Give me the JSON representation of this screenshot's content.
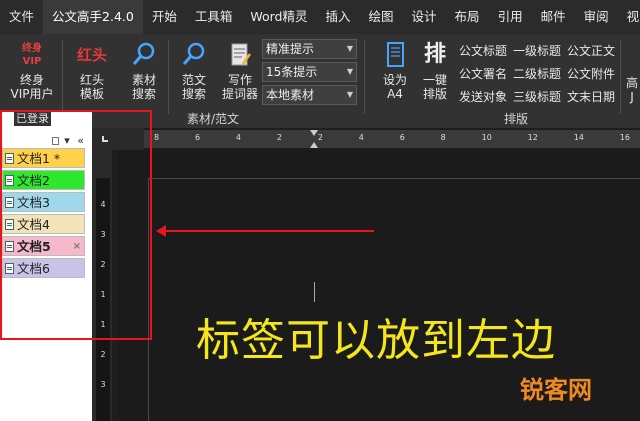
{
  "menubar": {
    "items": [
      "文件",
      "公文高手2.4.0",
      "开始",
      "工具箱",
      "Word精灵",
      "插入",
      "绘图",
      "设计",
      "布局",
      "引用",
      "邮件",
      "审阅",
      "视图"
    ],
    "active_index": 1
  },
  "ribbon": {
    "vip": {
      "icon_line1": "终身",
      "icon_line2": "VIP",
      "label_line1": "终身",
      "label_line2": "VIP用户"
    },
    "hongtou": {
      "icon": "红头",
      "label_line1": "红头",
      "label_line2": "模板"
    },
    "sucai": {
      "label_line1": "素材",
      "label_line2": "搜索"
    },
    "fanwen": {
      "label_line1": "范文",
      "label_line2": "搜索"
    },
    "xiezuo": {
      "label_line1": "写作",
      "label_line2": "提词器"
    },
    "combos": [
      "精准提示",
      "15条提示",
      "本地素材"
    ],
    "group_material": "素材/范文",
    "set_a4": {
      "label_line1": "设为",
      "label_line2": "A4"
    },
    "paiban": {
      "icon": "排",
      "label_line1": "一键",
      "label_line2": "排版"
    },
    "titles_col1": [
      "公文标题",
      "公文署名",
      "发送对象"
    ],
    "titles_col2": [
      "一级标题",
      "二级标题",
      "三级标题"
    ],
    "titles_col3": [
      "公文正文",
      "公文附件",
      "文末日期"
    ],
    "partial": {
      "line1": "高",
      "line2": "J"
    },
    "group_layout": "排版",
    "login_status": "已登录"
  },
  "tabs": [
    {
      "label": "文档1 *",
      "color": "#ffd24a"
    },
    {
      "label": "文档2",
      "color": "#2ee82e"
    },
    {
      "label": "文档3",
      "color": "#9fd8ea"
    },
    {
      "label": "文档4",
      "color": "#f3e3b8"
    },
    {
      "label": "文档5",
      "color": "#f7b8cc",
      "close": "×"
    },
    {
      "label": "文档6",
      "color": "#c9c3e8"
    }
  ],
  "panel_tools": "▾ «",
  "ruler": {
    "h_ticks": [
      "8",
      "6",
      "4",
      "2",
      "2",
      "4",
      "6",
      "8",
      "10",
      "12",
      "14",
      "16"
    ],
    "v_ticks": [
      "4",
      "3",
      "2",
      "1",
      "1",
      "2",
      "3"
    ]
  },
  "caption": "标签可以放到左边",
  "watermark": "锐客网",
  "colors": {
    "annotation": "#e8141e",
    "caption": "#f5e61c",
    "watermark": "#f08a20"
  }
}
